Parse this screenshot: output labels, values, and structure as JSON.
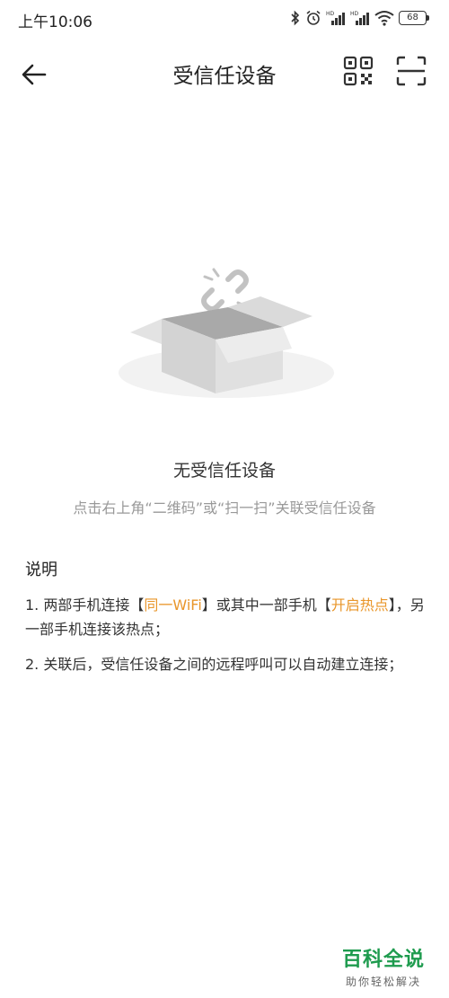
{
  "status_bar": {
    "time": "上午10:06",
    "battery": "68",
    "icons": [
      "bluetooth-icon",
      "alarm-icon",
      "signal-hd-icon",
      "signal-hd-icon",
      "wifi-icon",
      "battery-icon"
    ]
  },
  "header": {
    "title": "受信任设备",
    "back_icon": "arrow-left-icon",
    "qr_icon": "qr-code-icon",
    "scan_icon": "scan-icon"
  },
  "empty_state": {
    "title": "无受信任设备",
    "hint": "点击右上角“二维码”或“扫一扫”关联受信任设备"
  },
  "description": {
    "title": "说明",
    "item1": {
      "p1": "1. 两部手机连接【",
      "h1": "同一WiFi",
      "p2": "】或其中一部手机【",
      "h2": "开启热点",
      "p3": "】，另一部手机连接该热点；"
    },
    "item2": "2. 关联后，受信任设备之间的远程呼叫可以自动建立连接；"
  },
  "watermark": {
    "main": "百科全说",
    "sub": "助你轻松解决"
  },
  "colors": {
    "highlight": "#e9962a",
    "watermark_green": "#1e9b4e"
  }
}
